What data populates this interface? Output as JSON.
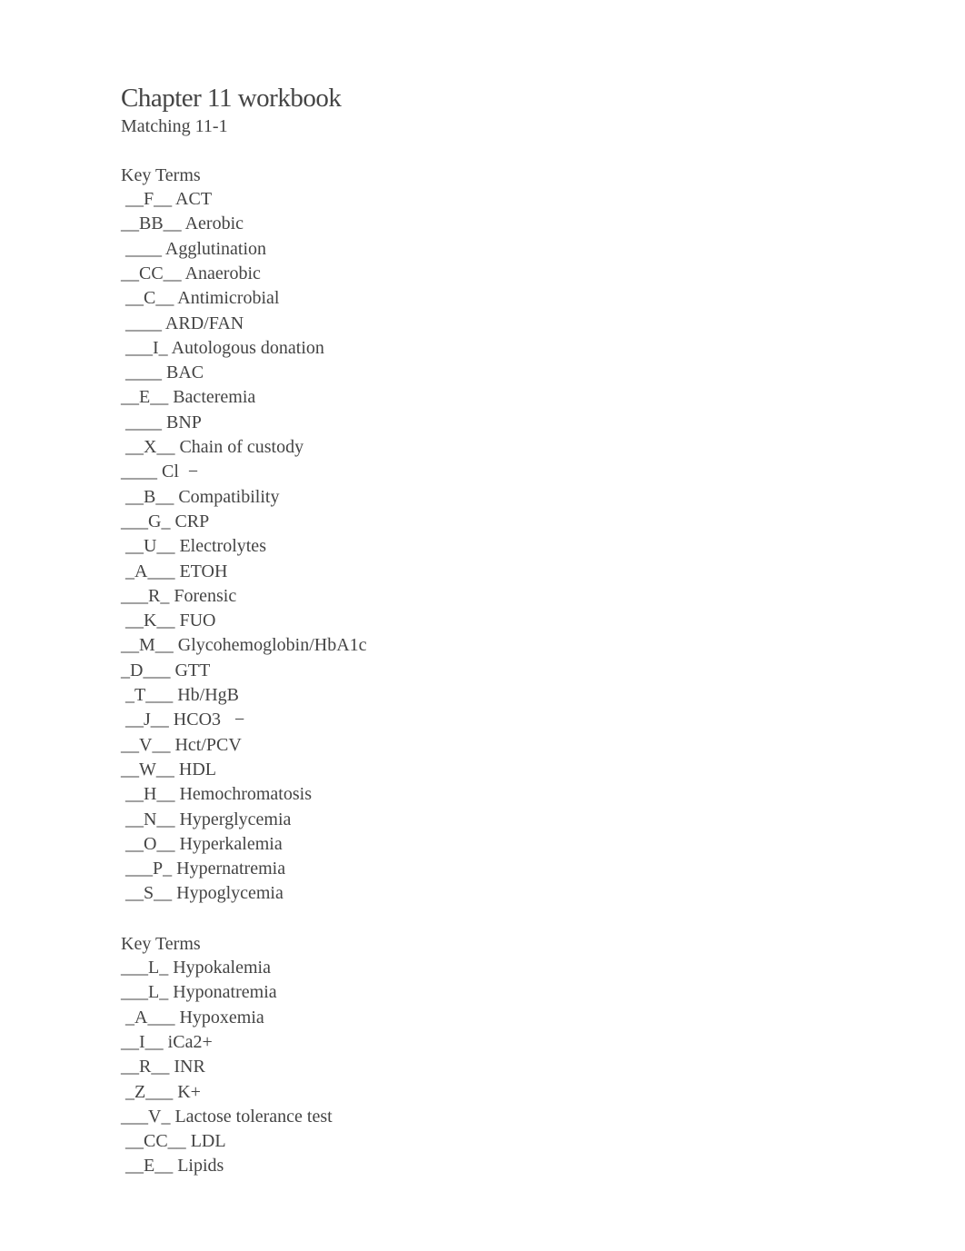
{
  "document": {
    "title": "Chapter 11 workbook",
    "subtitle": "Matching 11-1",
    "sections": [
      {
        "heading": "Key Terms",
        "items": [
          {
            "answer": " __F__",
            "term": "ACT"
          },
          {
            "answer": "__BB__",
            "term": "Aerobic"
          },
          {
            "answer": " ____",
            "term": "Agglutination"
          },
          {
            "answer": "__CC__",
            "term": "Anaerobic"
          },
          {
            "answer": " __C__",
            "term": "Antimicrobial"
          },
          {
            "answer": " ____",
            "term": "ARD/FAN"
          },
          {
            "answer": " ___I_",
            "term": "Autologous donation"
          },
          {
            "answer": " ____",
            "term": "BAC"
          },
          {
            "answer": "__E__",
            "term": "Bacteremia"
          },
          {
            "answer": " ____",
            "term": "BNP"
          },
          {
            "answer": " __X__",
            "term": "Chain of custody"
          },
          {
            "answer": "____",
            "term": "Cl  −"
          },
          {
            "answer": " __B__",
            "term": "Compatibility"
          },
          {
            "answer": "___G_",
            "term": "CRP"
          },
          {
            "answer": " __U__",
            "term": "Electrolytes"
          },
          {
            "answer": " _A___",
            "term": "ETOH"
          },
          {
            "answer": "___R_",
            "term": "Forensic"
          },
          {
            "answer": " __K__",
            "term": "FUO"
          },
          {
            "answer": "__M__",
            "term": "Glycohemoglobin/HbA1c"
          },
          {
            "answer": "_D___",
            "term": "GTT"
          },
          {
            "answer": " _T___",
            "term": "Hb/HgB"
          },
          {
            "answer": " __J__",
            "term": "HCO3   −"
          },
          {
            "answer": "__V__",
            "term": "Hct/PCV"
          },
          {
            "answer": "__W__",
            "term": "HDL"
          },
          {
            "answer": " __H__",
            "term": "Hemochromatosis"
          },
          {
            "answer": " __N__",
            "term": "Hyperglycemia"
          },
          {
            "answer": " __O__",
            "term": "Hyperkalemia"
          },
          {
            "answer": " ___P_",
            "term": "Hypernatremia"
          },
          {
            "answer": " __S__",
            "term": "Hypoglycemia"
          }
        ]
      },
      {
        "heading": "Key Terms",
        "items": [
          {
            "answer": "___L_",
            "term": "Hypokalemia"
          },
          {
            "answer": "___L_",
            "term": "Hyponatremia"
          },
          {
            "answer": " _A___",
            "term": "Hypoxemia"
          },
          {
            "answer": "__I__",
            "term": "iCa2+"
          },
          {
            "answer": "__R__",
            "term": "INR"
          },
          {
            "answer": " _Z___",
            "term": "K+"
          },
          {
            "answer": "___V_",
            "term": "Lactose tolerance test"
          },
          {
            "answer": " __CC__",
            "term": "LDL"
          },
          {
            "answer": " __E__",
            "term": "Lipids"
          }
        ]
      }
    ]
  }
}
